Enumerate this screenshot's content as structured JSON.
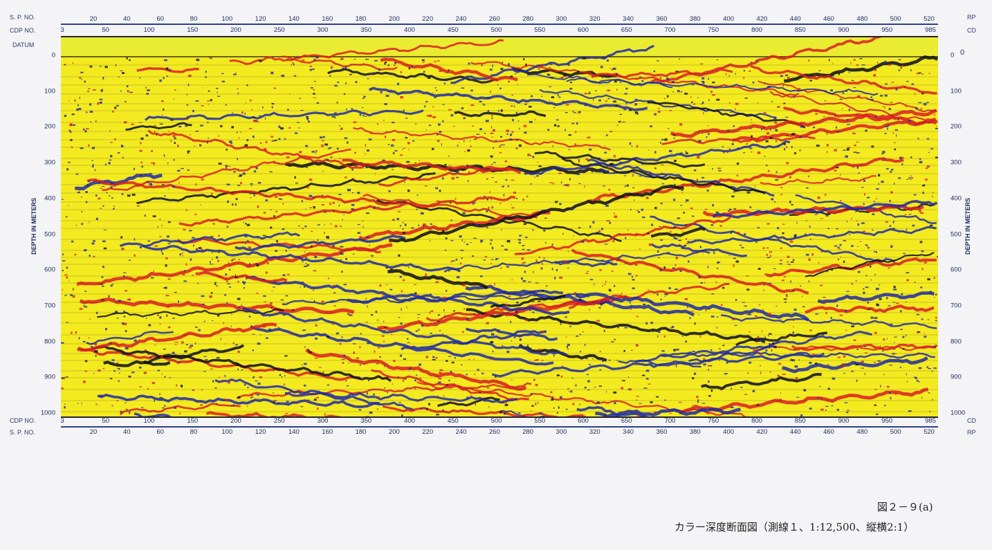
{
  "labels": {
    "sp_top": "S. P. NO.",
    "cdp_top": "CDP NO.",
    "datum": "DATUM",
    "cdp_bottom": "CDP NO.",
    "sp_bottom": "S. P. NO.",
    "rp_top": "RP",
    "cd_top": "CD",
    "cd_bottom": "CD",
    "rp_bottom": "RP",
    "depth_left": "DEPTH IN METERS",
    "depth_right": "DEPTH IN METERS",
    "datum_zero": "0"
  },
  "sp_ticks": [
    "20",
    "40",
    "60",
    "80",
    "100",
    "120",
    "140",
    "160",
    "180",
    "200",
    "220",
    "240",
    "260",
    "280",
    "300",
    "320",
    "340",
    "360",
    "380",
    "400",
    "420",
    "440",
    "460",
    "480",
    "500",
    "520"
  ],
  "cdp_ticks": [
    "3",
    "50",
    "100",
    "150",
    "200",
    "250",
    "300",
    "350",
    "400",
    "450",
    "500",
    "550",
    "600",
    "650",
    "700",
    "750",
    "800",
    "850",
    "900",
    "950",
    "985"
  ],
  "depth_ticks": [
    "0",
    "100",
    "200",
    "300",
    "400",
    "500",
    "600",
    "700",
    "800",
    "900",
    "1000"
  ],
  "caption": {
    "figure_no": "図２－９(a)",
    "title": "カラー深度断面図（測線１、1:12,500、縦横2:1）"
  },
  "colors": {
    "trace_yellow": "#f3ea20",
    "trace_red": "#d81e24",
    "trace_blue": "#1f2aa8",
    "trace_dark": "#0c0c20",
    "axis_blue": "#2b3f8a"
  }
}
